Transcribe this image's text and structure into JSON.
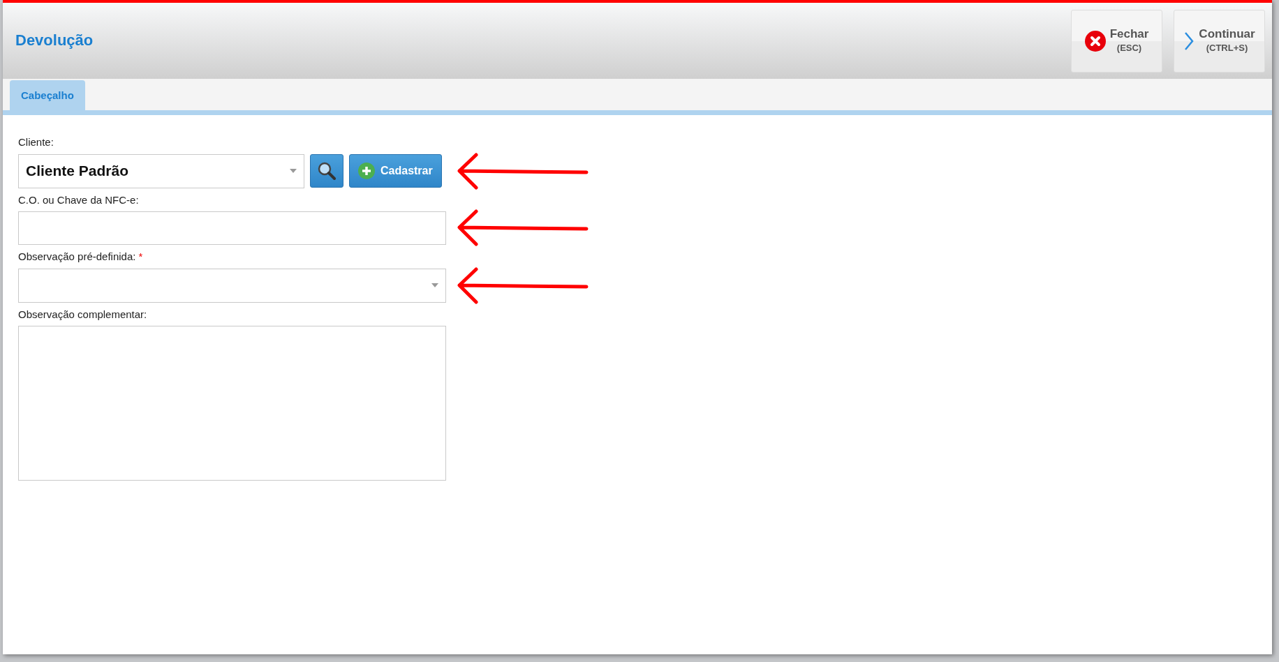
{
  "window": {
    "title": "Devolução"
  },
  "header_buttons": [
    {
      "kind": "close",
      "label": "Fechar",
      "shortcut": "(ESC)"
    },
    {
      "kind": "next",
      "label": "Continuar",
      "shortcut": "(CTRL+S)"
    }
  ],
  "tabs": [
    {
      "label": "Cabeçalho",
      "selected": true
    }
  ],
  "fields": [
    {
      "kind": "combo",
      "label": "Cliente:",
      "value": "Cliente Padrão",
      "buttons": [
        "Cadastrar"
      ],
      "annotation_arrow": {
        "color": "#ff0000"
      }
    },
    {
      "kind": "text",
      "label": "C.O. ou Chave da NFC-e:",
      "annotation_arrow": {
        "color": "#ff0000"
      }
    },
    {
      "kind": "select",
      "label": "Observação pré-definida:",
      "required_mark": "*",
      "annotation_arrow": {
        "color": "#ff0000"
      }
    },
    {
      "kind": "textarea",
      "label": "Observação complementar:"
    }
  ]
}
